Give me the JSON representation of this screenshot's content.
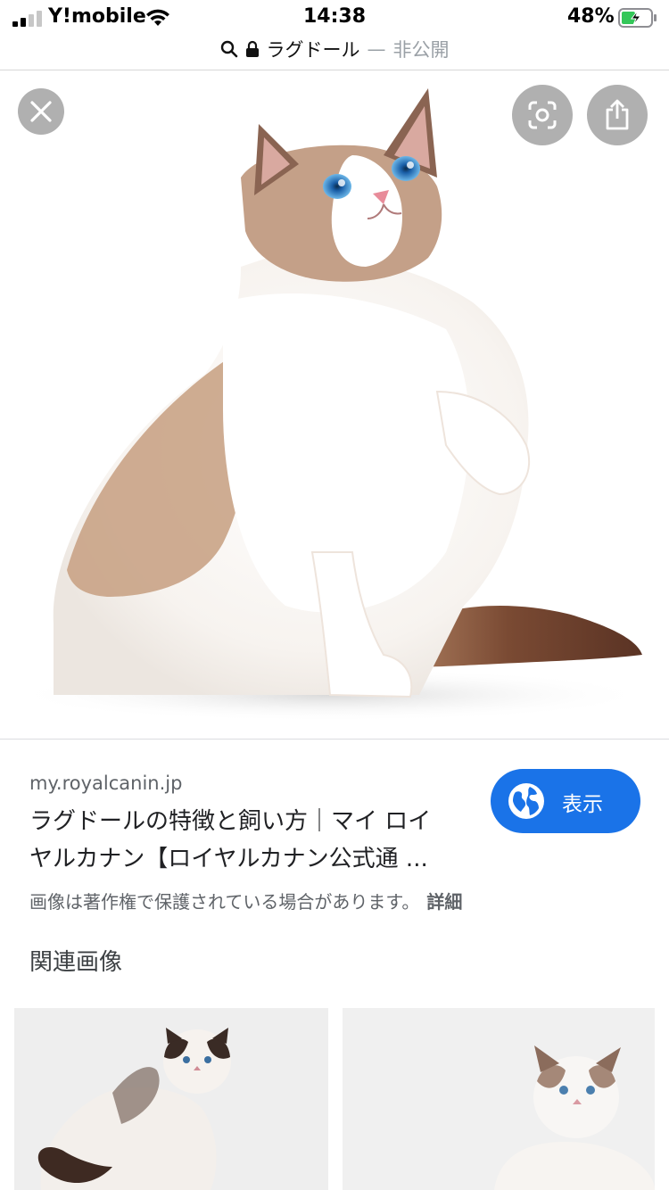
{
  "status_bar": {
    "carrier": "Y!mobile",
    "time": "14:38",
    "battery_percent": "48%",
    "battery_level": 0.48,
    "charging": true,
    "icons": [
      "signal-icon",
      "wifi-icon",
      "battery-icon"
    ]
  },
  "url_bar": {
    "title": "ラグドール",
    "separator": "—",
    "privacy": "非公開",
    "icons": [
      "search-icon",
      "lock-icon"
    ]
  },
  "viewer": {
    "icons": [
      "close-icon",
      "lens-icon",
      "share-icon"
    ]
  },
  "result": {
    "domain": "my.royalcanin.jp",
    "title_line1": "ラグドールの特徴と飼い方｜マイ ロイ",
    "title_line2": "ヤルカナン【ロイヤルカナン公式通 ...",
    "visit_label": "表示",
    "visit_icon": "globe-icon",
    "copyright_notice": "画像は著作権で保護されている場合があります。",
    "details_label": "詳細"
  },
  "related": {
    "heading": "関連画像"
  },
  "colors": {
    "accent": "#1a73e8",
    "text_primary": "#202124",
    "text_secondary": "#5f6368",
    "battery_green": "#34c759"
  }
}
